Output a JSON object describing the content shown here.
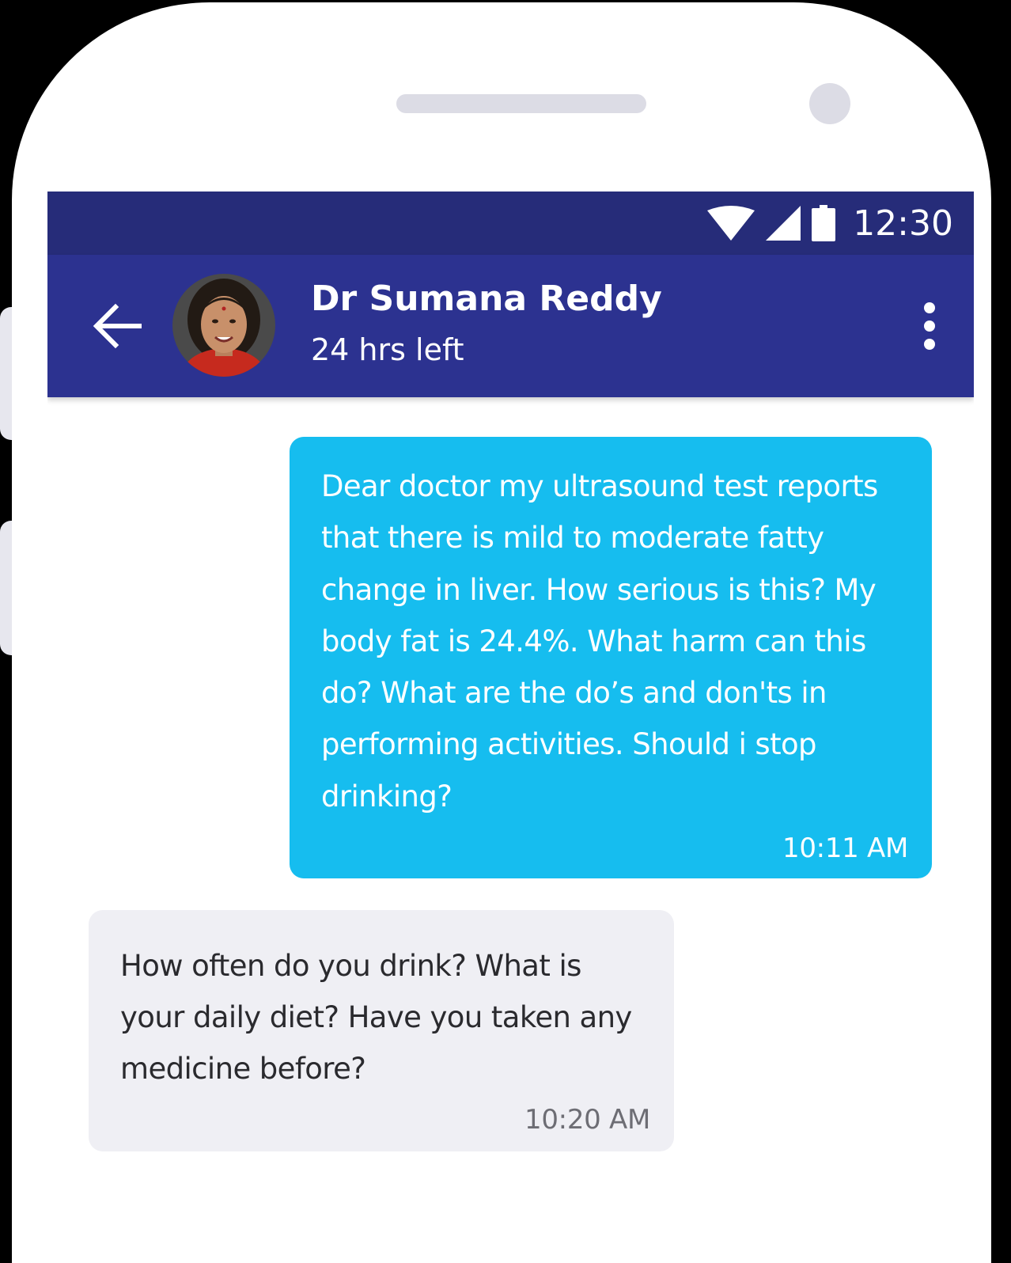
{
  "status_bar": {
    "time": "12:30",
    "icons": [
      "wifi-icon",
      "signal-icon",
      "battery-icon"
    ]
  },
  "header": {
    "back_icon": "arrow-left-icon",
    "contact_name": "Dr Sumana Reddy",
    "subtitle": "24 hrs left",
    "menu_icon": "more-vertical-icon"
  },
  "messages": [
    {
      "direction": "sent",
      "text": "Dear doctor my ultrasound test reports that there is mild to moderate fatty change in liver. How serious is this? My body fat is 24.4%. What harm can this do? What are the do’s and don'ts in performing activities. Should i stop drinking?",
      "time": "10:11 AM"
    },
    {
      "direction": "received",
      "text": "How often do you drink? What is your daily diet? Have you taken any medicine before?",
      "time": "10:20 AM"
    }
  ],
  "colors": {
    "status_bar": "#262c79",
    "app_bar": "#2c3290",
    "sent_bubble": "#16bdef",
    "received_bubble": "#efeff4"
  }
}
